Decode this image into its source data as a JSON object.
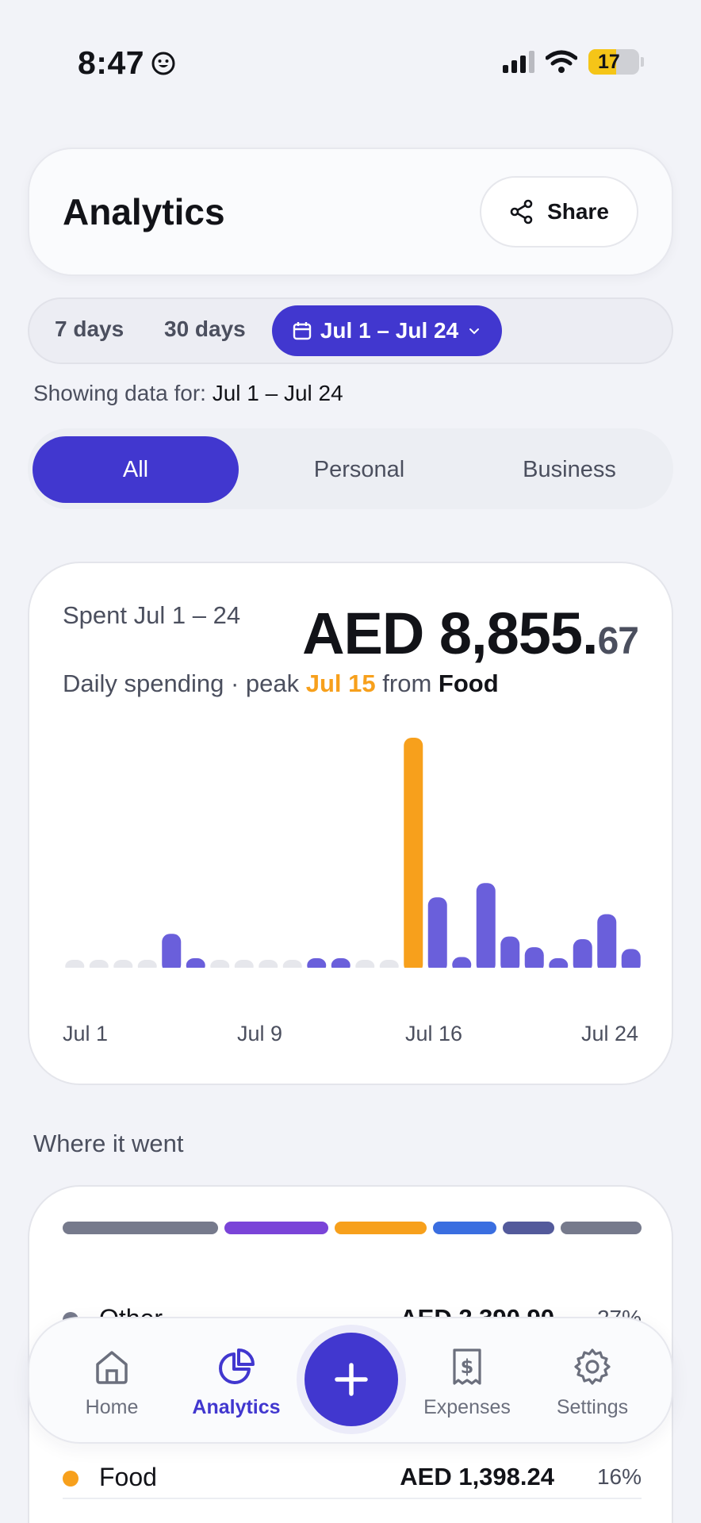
{
  "status_bar": {
    "time": "8:47",
    "battery": "17"
  },
  "header": {
    "title": "Analytics",
    "share_label": "Share"
  },
  "period": {
    "options": [
      "7 days",
      "30 days"
    ],
    "selected_range": "Jul 1 – Jul 24",
    "showing_prefix": "Showing data for:",
    "showing_value": "Jul 1 – Jul 24"
  },
  "filter": {
    "tabs": [
      "All",
      "Personal",
      "Business"
    ],
    "selected": "All"
  },
  "summary": {
    "spent_label": "Spent Jul 1 – 24",
    "total_main": "AED 8,855.",
    "total_cents": "67",
    "subtitle_prefix": "Daily spending · peak",
    "peak_day": "Jul 15",
    "subtitle_mid": "from",
    "peak_category": "Food"
  },
  "chart_data": {
    "type": "bar",
    "categories": [
      "Jul 1",
      "Jul 2",
      "Jul 3",
      "Jul 4",
      "Jul 5",
      "Jul 6",
      "Jul 7",
      "Jul 8",
      "Jul 9",
      "Jul 10",
      "Jul 11",
      "Jul 12",
      "Jul 13",
      "Jul 14",
      "Jul 15",
      "Jul 16",
      "Jul 17",
      "Jul 18",
      "Jul 19",
      "Jul 20",
      "Jul 21",
      "Jul 22",
      "Jul 23",
      "Jul 24"
    ],
    "values": [
      0,
      0,
      0,
      0,
      190,
      45,
      0,
      0,
      0,
      0,
      45,
      45,
      0,
      0,
      1290,
      395,
      60,
      475,
      175,
      115,
      50,
      160,
      300,
      105
    ],
    "peak_index": 14,
    "x_tick_labels": [
      "Jul 1",
      "Jul 9",
      "Jul 16",
      "Jul 24"
    ],
    "colors": {
      "bar": "#6a5fdb",
      "peak": "#f7a01c",
      "empty": "#e6e7ec"
    }
  },
  "breakdown": {
    "title": "Where it went",
    "segments": [
      {
        "color": "#767a8c",
        "share": 27
      },
      {
        "color": "#7a44d8",
        "share": 18
      },
      {
        "color": "#f7a01c",
        "share": 16
      },
      {
        "color": "#3a6ee0",
        "share": 11
      },
      {
        "color": "#535a9b",
        "share": 9
      },
      {
        "color": "#767a8c",
        "share": 14
      }
    ],
    "rows": [
      {
        "name": "Other",
        "amount": "AED 2,390.90",
        "pct": "27%",
        "color": "#767a8c"
      },
      {
        "name": "Food",
        "amount": "AED 1,398.24",
        "pct": "16%",
        "color": "#f7a01c"
      }
    ]
  },
  "nav": {
    "home": "Home",
    "analytics": "Analytics",
    "expenses": "Expenses",
    "settings": "Settings"
  }
}
